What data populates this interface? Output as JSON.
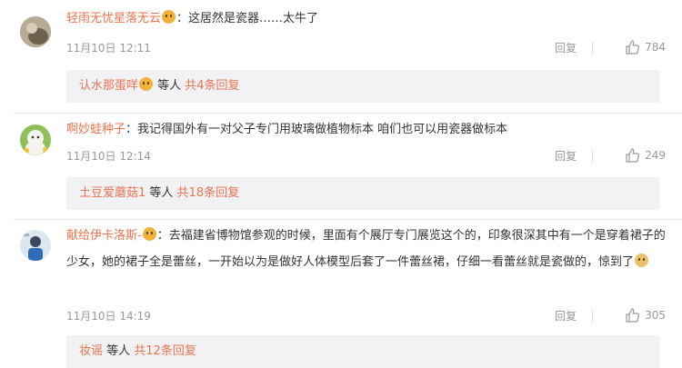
{
  "comments": [
    {
      "username": "轻雨无忧星落无云",
      "separator": "：",
      "text": "这居然是瓷器……太牛了",
      "time": "11月10日 12:11",
      "reply_label": "回复",
      "likes": "784",
      "reply_summary": {
        "first_replier": "认水那蛋咩",
        "middle": " 等人 ",
        "total": "共4条回复"
      }
    },
    {
      "username": "啊妙蛙种子",
      "separator": "：",
      "text": "我记得国外有一对父子专门用玻璃做植物标本 咱们也可以用瓷器做标本",
      "time": "11月10日 12:14",
      "reply_label": "回复",
      "likes": "249",
      "reply_summary": {
        "first_replier": "土豆爱蘑菇1",
        "middle": " 等人 ",
        "total": "共18条回复"
      }
    },
    {
      "username": "献给伊卡洛斯-",
      "separator": "：",
      "text": "去福建省博物馆参观的时候，里面有个展厅专门展览这个的，印象很深其中有一个是穿着裙子的少女，她的裙子全是蕾丝，一开始以为是做好人体模型后套了一件蕾丝裙，仔细一看蕾丝就是瓷做的，惊到了",
      "time": "11月10日 14:19",
      "reply_label": "回复",
      "likes": "305",
      "reply_summary": {
        "first_replier": "妆谣",
        "middle": " 等人 ",
        "total": "共12条回复"
      }
    }
  ]
}
